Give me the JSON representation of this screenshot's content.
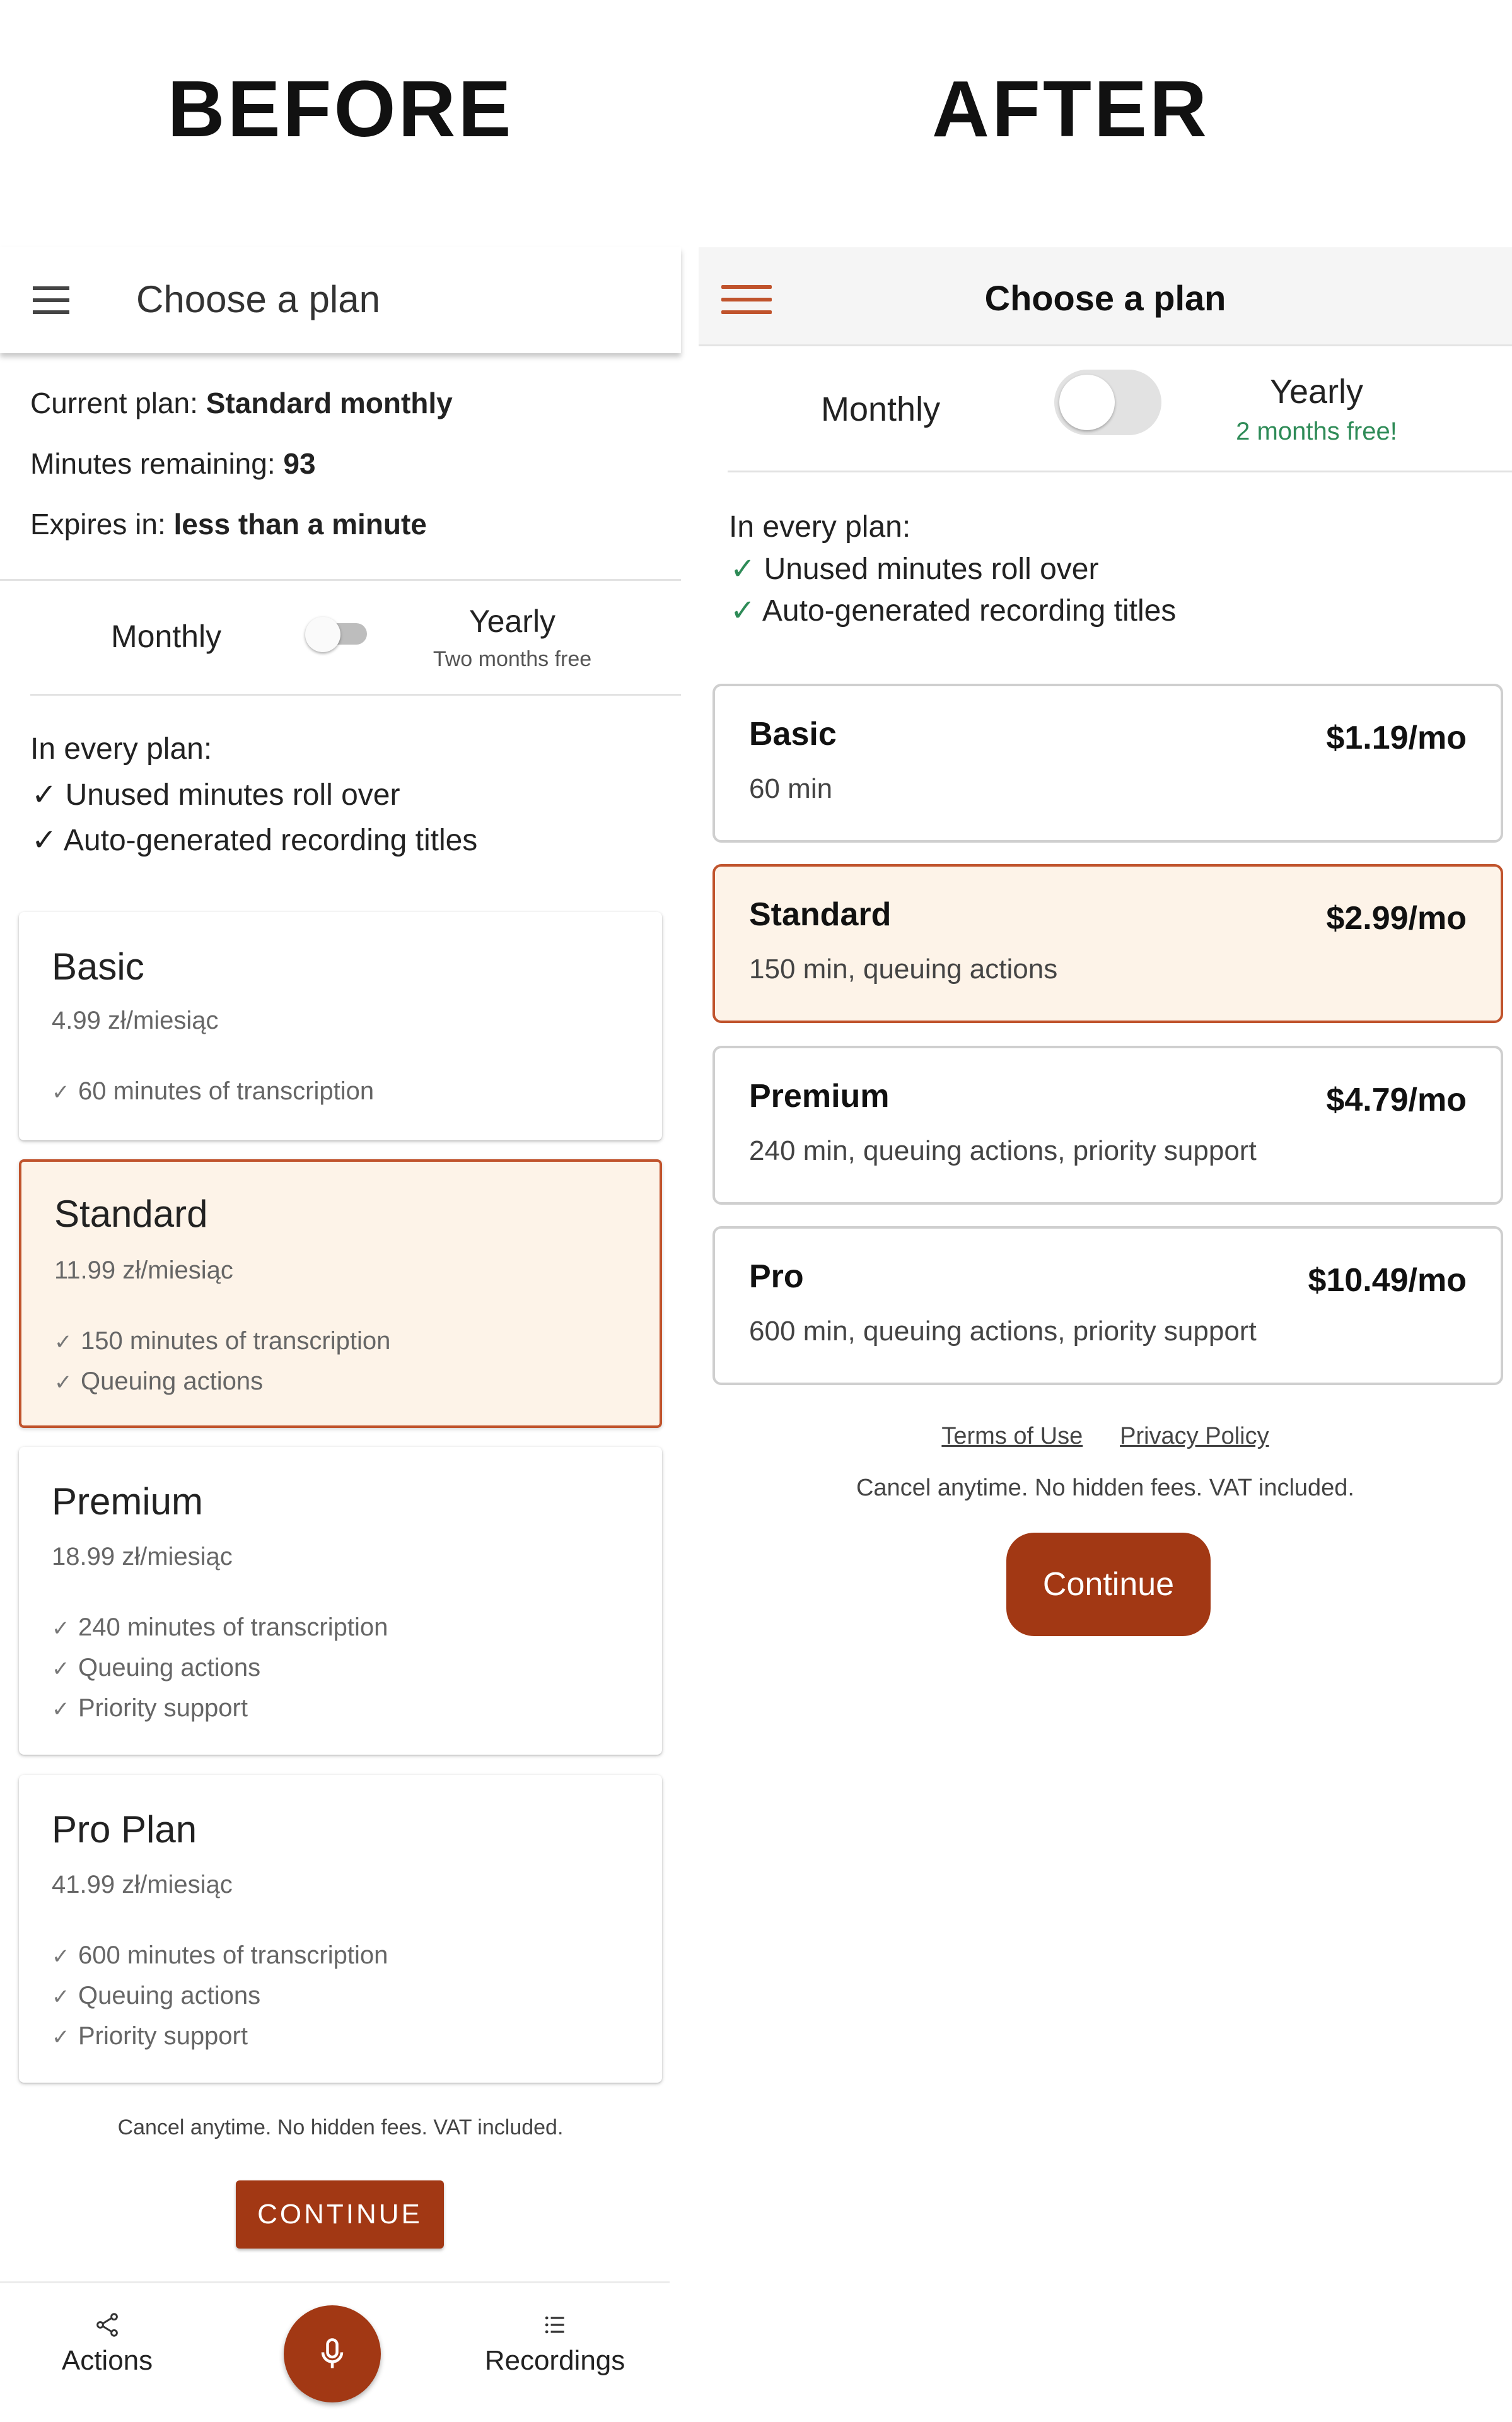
{
  "headings": {
    "before": "BEFORE",
    "after": "AFTER"
  },
  "before": {
    "app_title": "Choose a plan",
    "info": {
      "current_plan_label": "Current plan: ",
      "current_plan_value": "Standard monthly",
      "minutes_label": "Minutes remaining: ",
      "minutes_value": "93",
      "expires_label": "Expires in: ",
      "expires_value": "less than a minute"
    },
    "billing": {
      "monthly": "Monthly",
      "yearly": "Yearly",
      "yearly_sub": "Two months free",
      "yearly_selected": false
    },
    "features_title": "In every plan:",
    "features": [
      "Unused minutes roll over",
      "Auto-generated recording titles"
    ],
    "check_glyph": "✓",
    "plans": [
      {
        "name": "Basic",
        "price": "4.99 zł/miesiąc",
        "features": [
          "60 minutes of transcription"
        ],
        "selected": false
      },
      {
        "name": "Standard",
        "price": "11.99 zł/miesiąc",
        "features": [
          "150 minutes of transcription",
          "Queuing actions"
        ],
        "selected": true
      },
      {
        "name": "Premium",
        "price": "18.99 zł/miesiąc",
        "features": [
          "240 minutes of transcription",
          "Queuing actions",
          "Priority support"
        ],
        "selected": false
      },
      {
        "name": "Pro Plan",
        "price": "41.99 zł/miesiąc",
        "features": [
          "600 minutes of transcription",
          "Queuing actions",
          "Priority support"
        ],
        "selected": false
      }
    ],
    "footnote": "Cancel anytime. No hidden fees. VAT included.",
    "continue_label": "CONTINUE",
    "nav": {
      "actions": "Actions",
      "recordings": "Recordings",
      "fab_icon": "microphone-icon"
    }
  },
  "after": {
    "app_title": "Choose a plan",
    "billing": {
      "monthly": "Monthly",
      "yearly": "Yearly",
      "yearly_sub": "2 months free!",
      "yearly_selected": false
    },
    "features_title": "In every plan:",
    "features": [
      "Unused minutes roll over",
      "Auto-generated recording titles"
    ],
    "check_glyph": "✓",
    "plans": [
      {
        "name": "Basic",
        "price": "$1.19/mo",
        "desc": "60 min",
        "selected": false
      },
      {
        "name": "Standard",
        "price": "$2.99/mo",
        "desc": "150 min, queuing actions",
        "selected": true
      },
      {
        "name": "Premium",
        "price": "$4.79/mo",
        "desc": "240 min, queuing actions, priority support",
        "selected": false
      },
      {
        "name": "Pro",
        "price": "$10.49/mo",
        "desc": "600 min, queuing actions, priority support",
        "selected": false
      }
    ],
    "links": {
      "terms": "Terms of Use",
      "privacy": "Privacy Policy"
    },
    "footnote": "Cancel anytime. No hidden fees. VAT included.",
    "continue_label": "Continue"
  },
  "colors": {
    "accent": "#a23814",
    "selected_border": "#c0532c",
    "selected_bg": "#fdf3e8",
    "yearly_sub_after": "#2e8b57"
  }
}
